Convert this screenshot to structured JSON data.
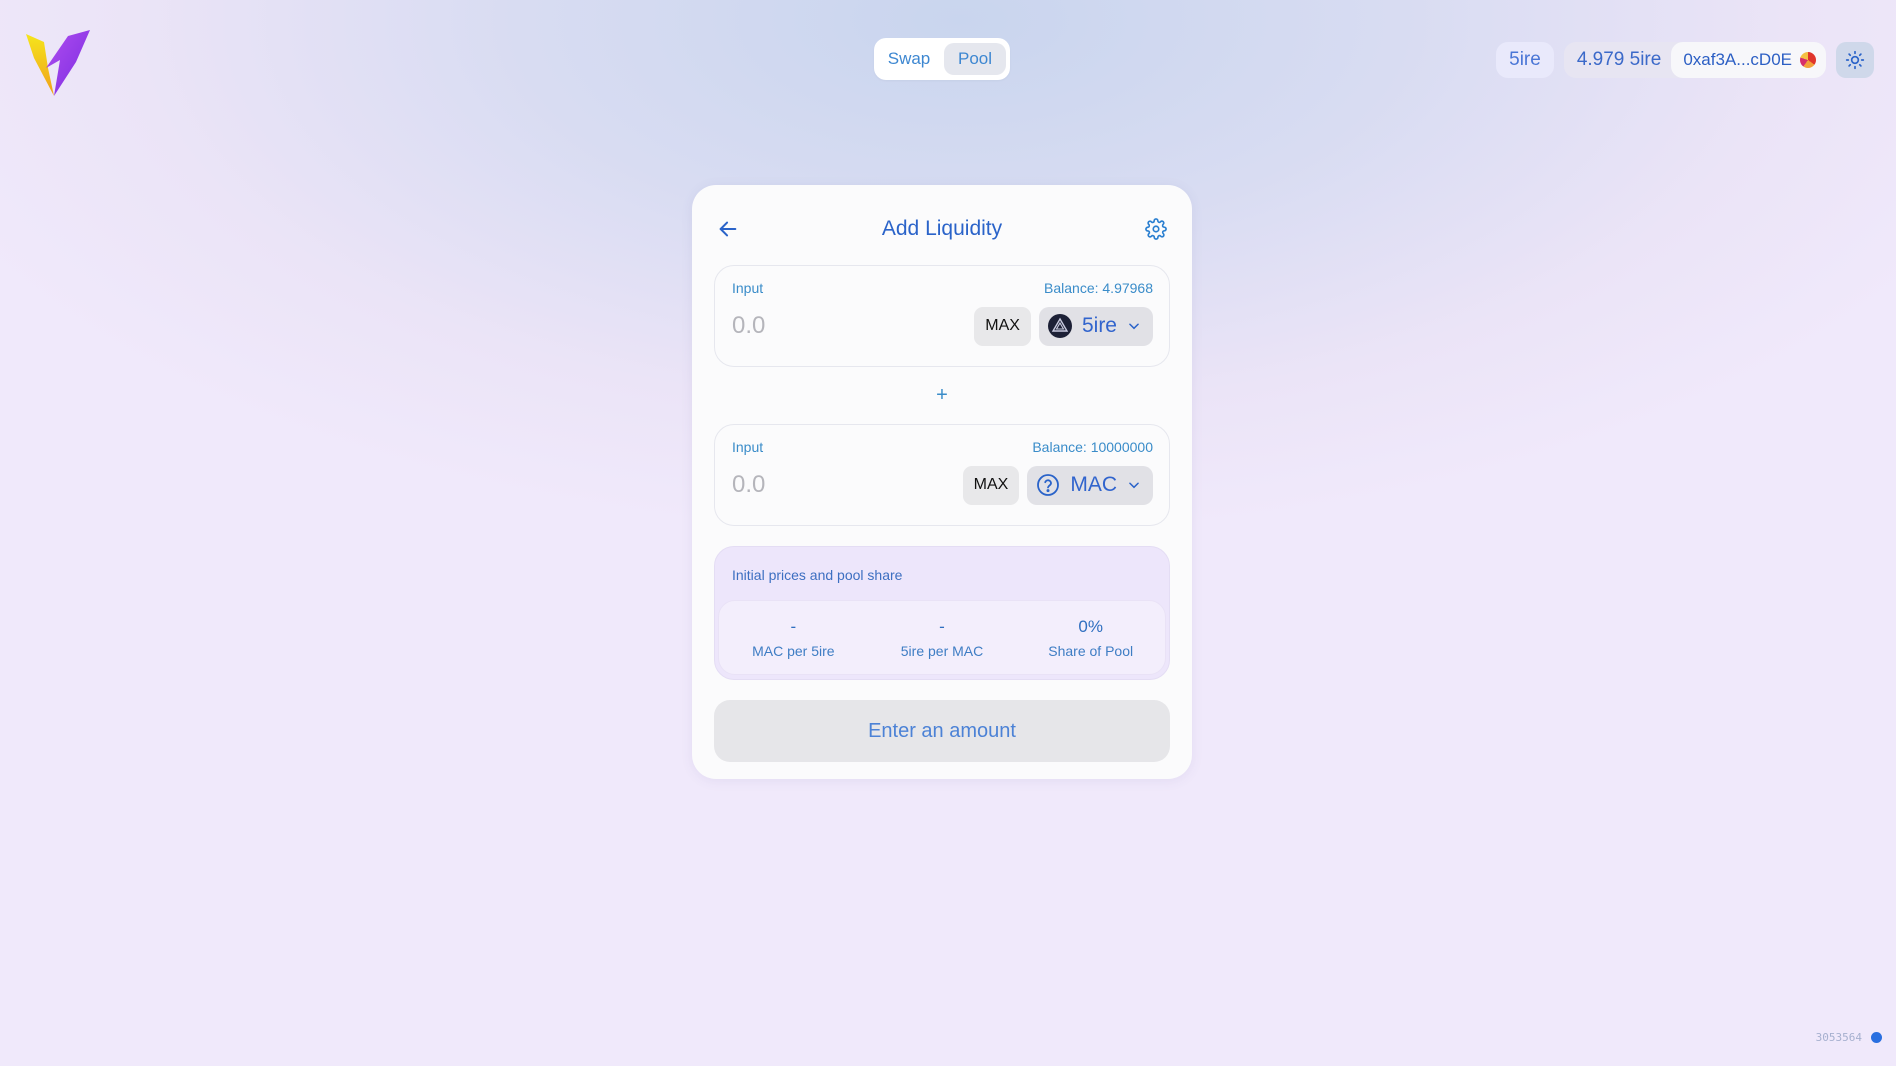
{
  "nav": {
    "tabs": [
      {
        "label": "Swap"
      },
      {
        "label": "Pool"
      }
    ],
    "active": "Pool"
  },
  "header": {
    "network": "5ire",
    "balance": "4.979 5ire",
    "address": "0xaf3A...cD0E",
    "theme_icon": "sun-icon"
  },
  "card": {
    "title": "Add Liquidity",
    "back_icon": "arrow-left-icon",
    "settings_icon": "gear-icon",
    "inputs": [
      {
        "label": "Input",
        "balance": "Balance: 4.97968",
        "placeholder": "0.0",
        "max": "MAX",
        "token": "5ire",
        "token_icon": "5ire-logo-icon"
      },
      {
        "label": "Input",
        "balance": "Balance: 10000000",
        "placeholder": "0.0",
        "max": "MAX",
        "token": "MAC",
        "token_icon": "question-circle-icon"
      }
    ],
    "plus": "+",
    "prices": {
      "title": "Initial prices and pool share",
      "items": [
        {
          "value": "-",
          "label": "MAC per 5ire"
        },
        {
          "value": "-",
          "label": "5ire per MAC"
        },
        {
          "value": "0%",
          "label": "Share of Pool"
        }
      ]
    },
    "submit": "Enter an amount"
  },
  "footer": {
    "block": "3053564"
  },
  "colors": {
    "accent": "#2a63c9",
    "link": "#3a8cc9",
    "status_dot": "#2a6fe0"
  }
}
